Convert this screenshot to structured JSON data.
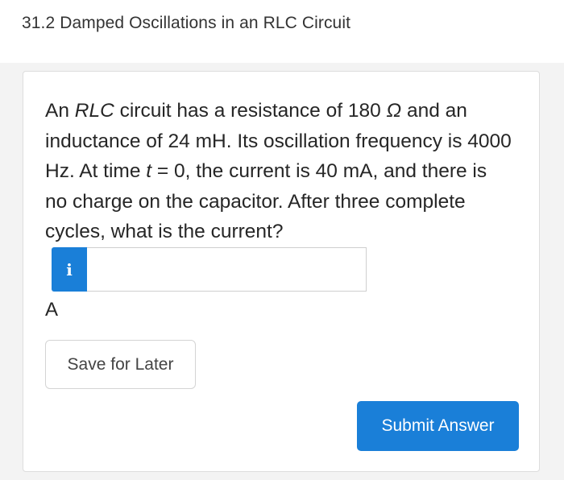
{
  "header": {
    "title": "31.2 Damped Oscillations in an RLC Circuit"
  },
  "question": {
    "part1": "An ",
    "part2": "RLC",
    "part3": " circuit has a resistance of 180 ",
    "part4": "Ω",
    "part5": " and an inductance of 24 mH. Its oscillation frequency is 4000 Hz. At time ",
    "part6": "t",
    "part7": " = 0, the current is 40 mA, and there is no charge on the capacitor. After three complete cycles, what is the current?"
  },
  "answer": {
    "info_label": "i",
    "value": "",
    "placeholder": "",
    "unit": "A"
  },
  "buttons": {
    "save_label": "Save for Later",
    "submit_label": "Submit Answer"
  },
  "colors": {
    "accent": "#1a7fd8",
    "background": "#f3f3f3"
  }
}
